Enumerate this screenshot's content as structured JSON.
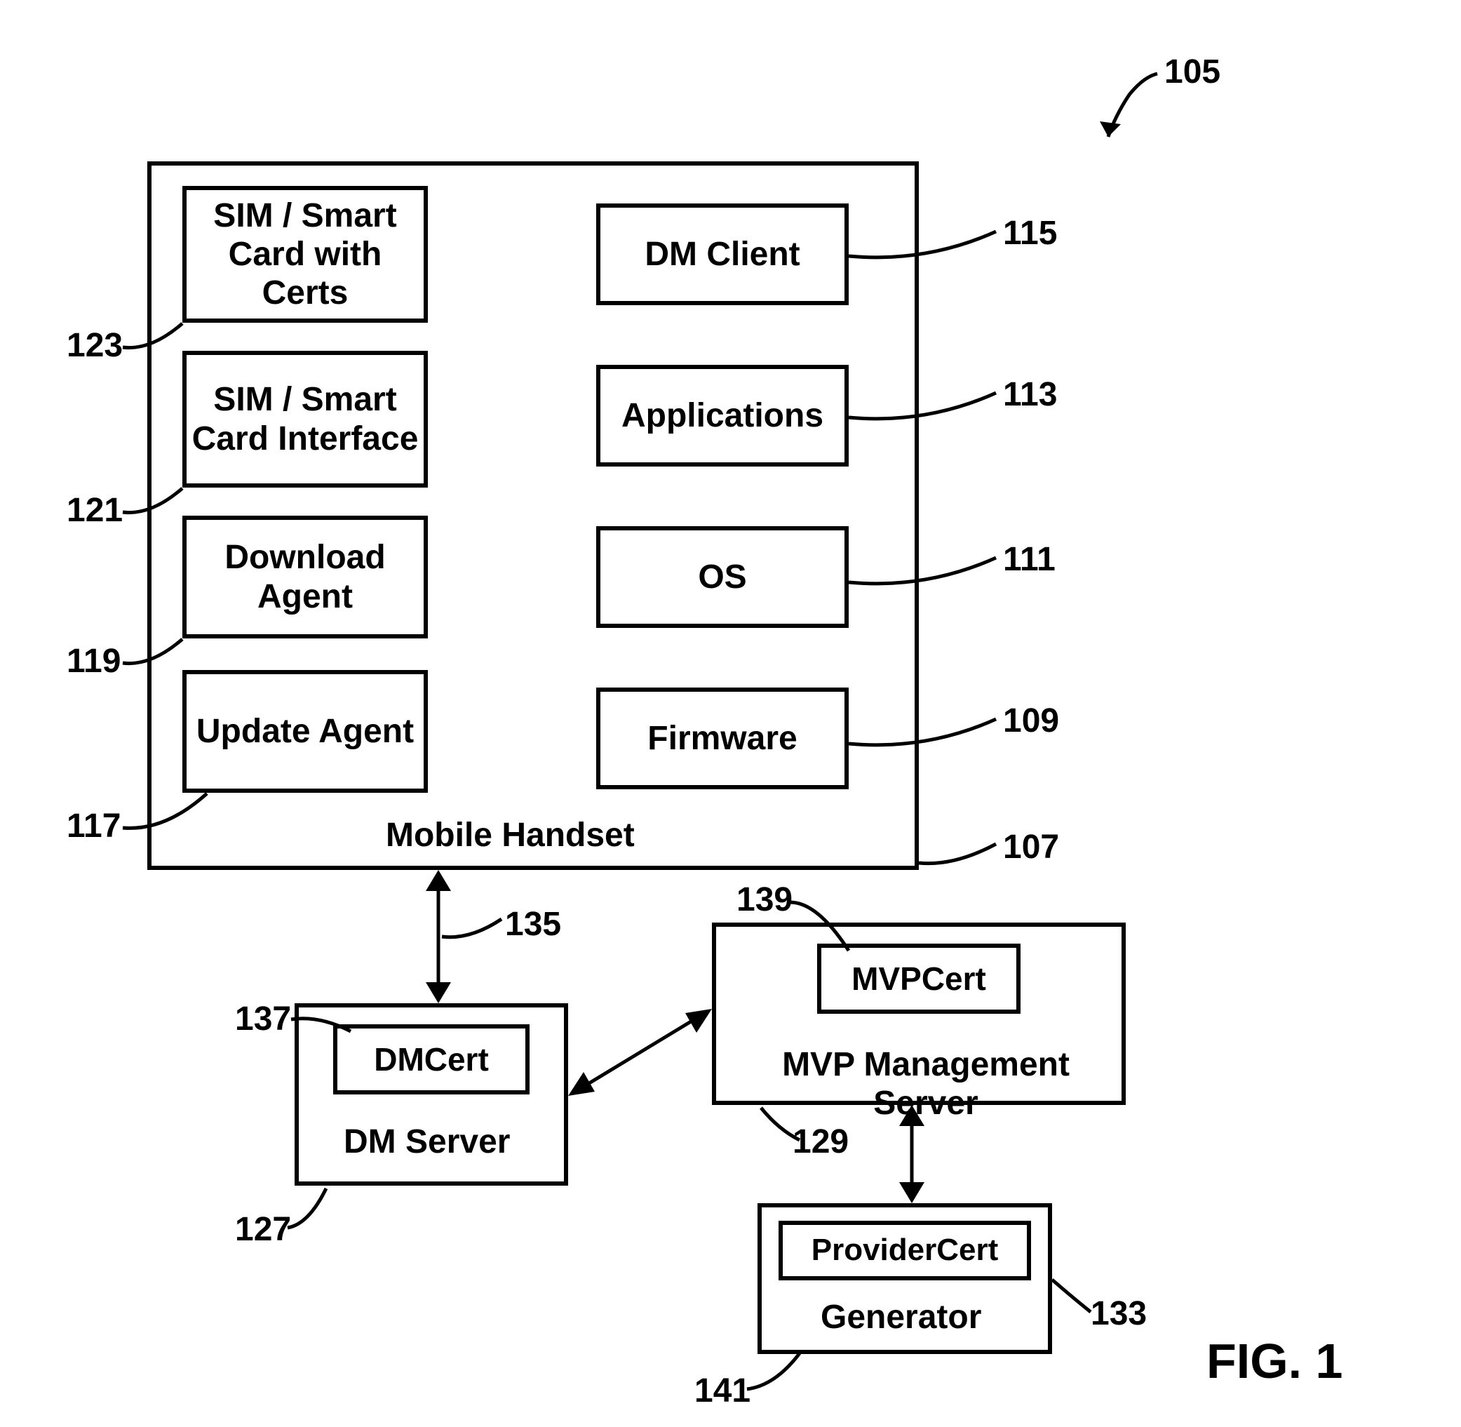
{
  "figure_ref": "105",
  "figure_label": "FIG. 1",
  "handset": {
    "title": "Mobile Handset",
    "ref": "107",
    "modules": {
      "sim_certs": {
        "label": "SIM / Smart Card with Certs",
        "ref": "123"
      },
      "sim_interface": {
        "label": "SIM / Smart Card Interface",
        "ref": "121"
      },
      "download_agent": {
        "label": "Download Agent",
        "ref": "119"
      },
      "update_agent": {
        "label": "Update Agent",
        "ref": "117"
      },
      "dm_client": {
        "label": "DM Client",
        "ref": "115"
      },
      "applications": {
        "label": "Applications",
        "ref": "113"
      },
      "os": {
        "label": "OS",
        "ref": "111"
      },
      "firmware": {
        "label": "Firmware",
        "ref": "109"
      }
    }
  },
  "dm_server": {
    "title": "DM Server",
    "ref": "127",
    "cert": {
      "label": "DMCert",
      "ref": "137"
    },
    "arrow_ref": "135"
  },
  "mvp_server": {
    "title": "MVP Management Server",
    "ref": "129",
    "cert": {
      "label": "MVPCert",
      "ref": "139"
    }
  },
  "generator": {
    "title": "Generator",
    "ref": "133",
    "cert": {
      "label": "ProviderCert",
      "ref": "141"
    }
  }
}
